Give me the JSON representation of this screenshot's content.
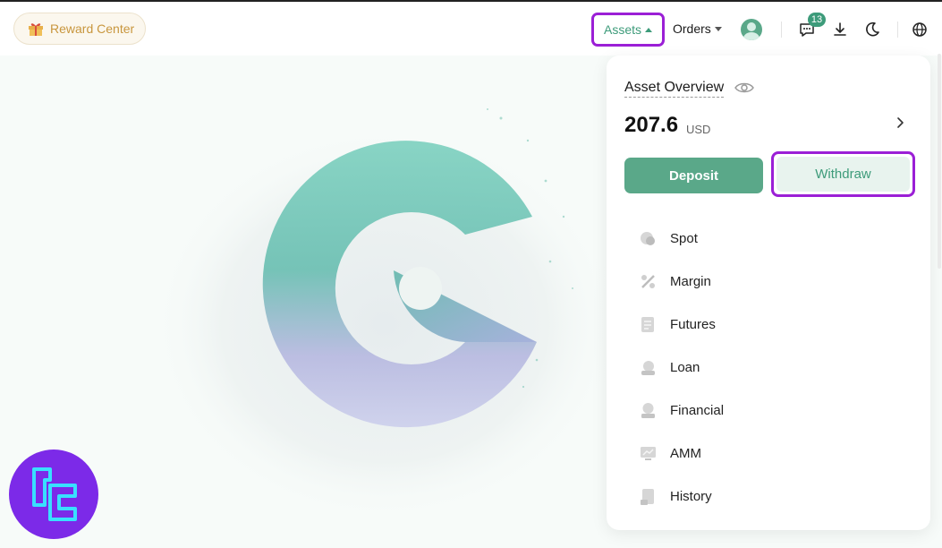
{
  "header": {
    "reward_center": "Reward Center",
    "assets_label": "Assets",
    "orders_label": "Orders",
    "notifications_count": "13",
    "icons": [
      "gift-icon",
      "avatar",
      "message-icon",
      "download-icon",
      "moon-icon",
      "globe-icon"
    ]
  },
  "asset_panel": {
    "title": "Asset Overview",
    "amount": "207.6",
    "currency": "USD",
    "deposit_label": "Deposit",
    "withdraw_label": "Withdraw",
    "items": [
      {
        "label": "Spot",
        "icon": "spot-icon"
      },
      {
        "label": "Margin",
        "icon": "margin-icon"
      },
      {
        "label": "Futures",
        "icon": "futures-icon"
      },
      {
        "label": "Loan",
        "icon": "loan-icon"
      },
      {
        "label": "Financial",
        "icon": "financial-icon"
      },
      {
        "label": "AMM",
        "icon": "amm-icon"
      },
      {
        "label": "History",
        "icon": "history-icon"
      }
    ]
  },
  "colors": {
    "accent": "#5aa889",
    "accent_text": "#3d9b7a",
    "highlight_outline": "#9b1fd6",
    "reward_text": "#c8963d",
    "watermark_bg": "#7c2ae8"
  }
}
